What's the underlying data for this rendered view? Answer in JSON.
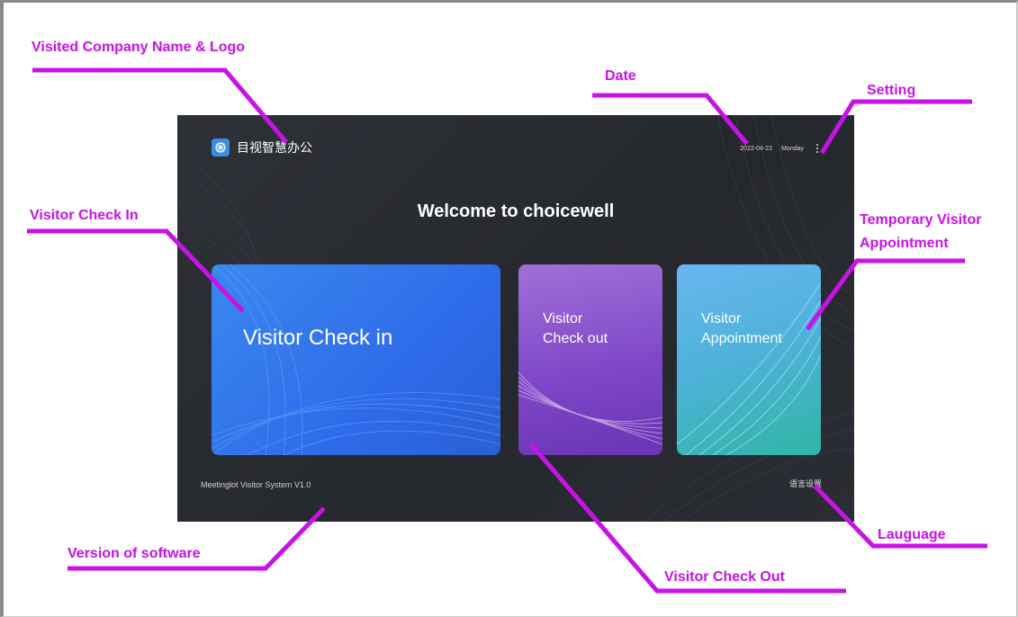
{
  "app": {
    "company_name": "目视智慧办公",
    "date": "2022-04-22",
    "weekday": "Monday",
    "welcome": "Welcome to choicewell",
    "cards": {
      "checkin": "Visitor Check in",
      "checkout": "Visitor\nCheck out",
      "appointment": "Visitor\nAppointment"
    },
    "version": "Meetinglot Visitor System V1.0",
    "language": "语言设置"
  },
  "annotations": {
    "company": "Visited Company Name & Logo",
    "date": "Date",
    "setting": "Setting",
    "checkin": "Visitor Check In",
    "temp_line1": "Temporary Visitor",
    "temp_line2": "Appointment",
    "version": "Version of software",
    "checkout": "Visitor Check Out",
    "language": "Lauguage"
  },
  "colors": {
    "annotation": "#c812e6",
    "screen_bg": "#2a2d33",
    "checkin_card": "#2f6cea",
    "checkout_card": "#8048c8",
    "appointment_card": "#3fb3c4"
  },
  "icons": {
    "logo": "company-logo-icon",
    "settings": "kebab-menu-icon"
  }
}
